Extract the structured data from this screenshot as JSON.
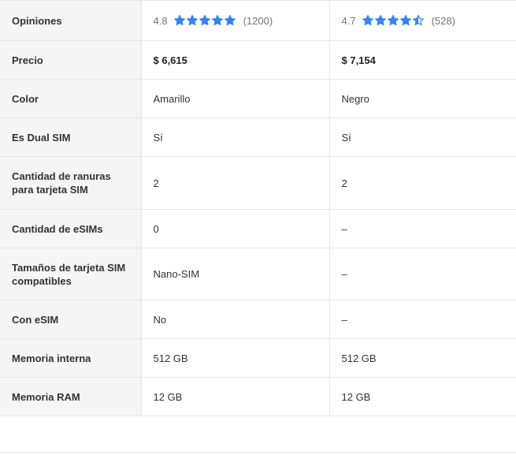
{
  "colors": {
    "star": "#3483fa",
    "label_bg": "#f5f5f5",
    "border": "#e6e6e6"
  },
  "rows": [
    {
      "label": "Opiniones",
      "a": {
        "rating": "4.8",
        "stars_value": 4.8,
        "count": "(1200)"
      },
      "b": {
        "rating": "4.7",
        "stars_value": 4.7,
        "count": "(528)"
      }
    },
    {
      "label": "Precio",
      "a": "$ 6,615",
      "b": "$ 7,154"
    },
    {
      "label": "Color",
      "a": "Amarillo",
      "b": "Negro"
    },
    {
      "label": "Es Dual SIM",
      "a": "Sí",
      "b": "Sí"
    },
    {
      "label": "Cantidad de ranuras para tarjeta SIM",
      "a": "2",
      "b": "2"
    },
    {
      "label": "Cantidad de eSIMs",
      "a": "0",
      "b": "–"
    },
    {
      "label": "Tamaños de tarjeta SIM compatibles",
      "a": "Nano-SIM",
      "b": "–"
    },
    {
      "label": "Con eSIM",
      "a": "No",
      "b": "–"
    },
    {
      "label": "Memoria interna",
      "a": "512 GB",
      "b": "512 GB"
    },
    {
      "label": "Memoria RAM",
      "a": "12 GB",
      "b": "12 GB"
    }
  ]
}
